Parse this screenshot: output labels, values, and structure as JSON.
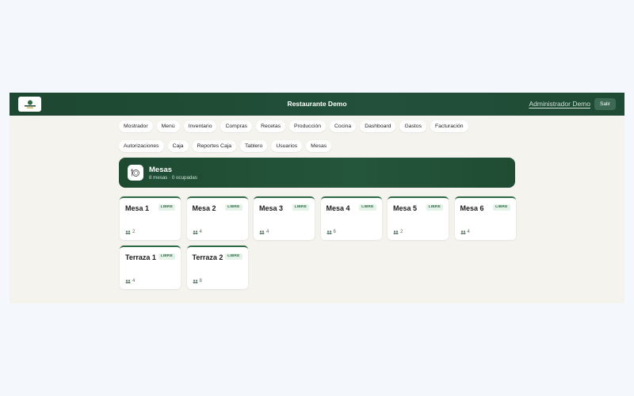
{
  "header": {
    "app_title": "Restaurante Demo",
    "user_name": "Administrador Demo",
    "logout_label": "Salir"
  },
  "nav": {
    "row1": [
      "Mostrador",
      "Menú",
      "Inventario",
      "Compras",
      "Recetas",
      "Producción",
      "Cocina",
      "Dashboard",
      "Gastos",
      "Facturación"
    ],
    "row2": [
      "Autorizaciones",
      "Caja",
      "Reportes Caja",
      "Tablero",
      "Usuarios",
      "Mesas"
    ]
  },
  "banner": {
    "title": "Mesas",
    "subtitle": "8 mesas · 0 ocupadas",
    "icon": "plate-icon"
  },
  "tables": [
    {
      "name": "Mesa 1",
      "status": "LIBRE",
      "seats": "2"
    },
    {
      "name": "Mesa 2",
      "status": "LIBRE",
      "seats": "4"
    },
    {
      "name": "Mesa 3",
      "status": "LIBRE",
      "seats": "4"
    },
    {
      "name": "Mesa 4",
      "status": "LIBRE",
      "seats": "6"
    },
    {
      "name": "Mesa 5",
      "status": "LIBRE",
      "seats": "2"
    },
    {
      "name": "Mesa 6",
      "status": "LIBRE",
      "seats": "4"
    },
    {
      "name": "Terraza 1",
      "status": "LIBRE",
      "seats": "4"
    },
    {
      "name": "Terraza 2",
      "status": "LIBRE",
      "seats": "8"
    }
  ],
  "colors": {
    "brand": "#1d4730",
    "accent": "#2f6a47",
    "badge_bg": "#e4f2e8"
  }
}
